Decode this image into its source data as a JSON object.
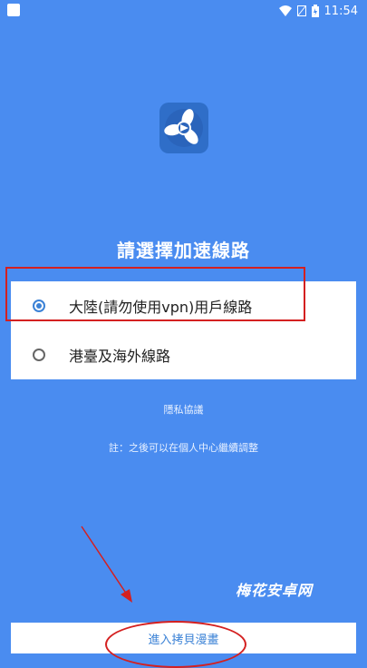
{
  "status_bar": {
    "time": "11:54",
    "icons": [
      "app-notification-icon",
      "wifi-icon",
      "no-signal-icon",
      "battery-icon"
    ]
  },
  "app": {
    "logo_icon": "app-logo-icon"
  },
  "title": "請選擇加速線路",
  "options": [
    {
      "label": "大陸(請勿使用vpn)用戶線路",
      "selected": true
    },
    {
      "label": "港臺及海外線路",
      "selected": false
    }
  ],
  "privacy_link": "隱私協議",
  "note": "註：之後可以在個人中心繼續調整",
  "watermark": "梅花安卓网",
  "enter_button": "進入拷貝漫畫",
  "colors": {
    "background": "#4a8cf0",
    "accent": "#3b82d6",
    "annotation": "#d42020"
  }
}
